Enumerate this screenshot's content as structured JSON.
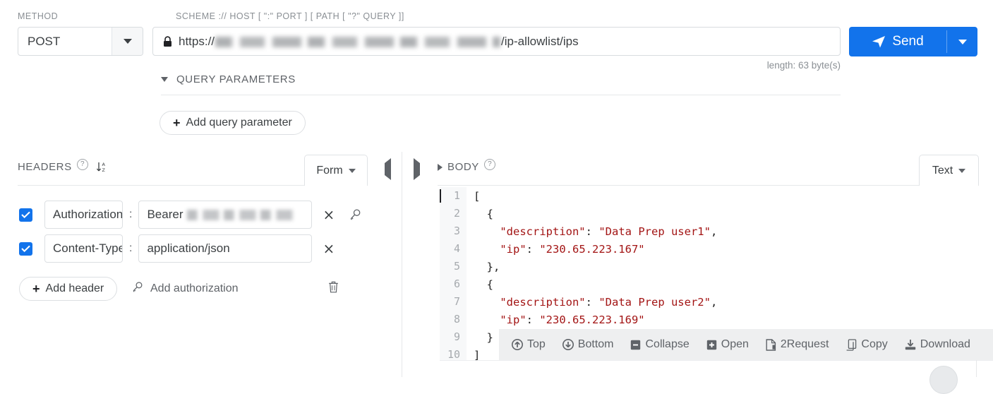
{
  "request": {
    "method_label": "METHOD",
    "method_value": "POST",
    "url_label": "SCHEME :// HOST [ \":\" PORT ] [ PATH [ \"?\" QUERY ]]",
    "url_scheme": "https://",
    "url_path": "/ip-allowlist/ips",
    "url_host_redacted": true,
    "send_label": "Send",
    "length_note": "length: 63 byte(s)"
  },
  "query_params": {
    "title": "QUERY PARAMETERS",
    "expanded": true,
    "add_label": "Add query parameter"
  },
  "headers_panel": {
    "title": "HEADERS",
    "view_mode": "Form",
    "rows": [
      {
        "enabled": true,
        "key": "Authorization",
        "value_prefix": "Bearer",
        "value_redacted": true,
        "has_key_icon": true
      },
      {
        "enabled": true,
        "key": "Content-Type",
        "value_prefix": "application/json",
        "value_redacted": false,
        "has_key_icon": false
      }
    ],
    "add_header_label": "Add header",
    "add_authorization_label": "Add authorization"
  },
  "body_panel": {
    "title": "BODY",
    "expanded": false,
    "view_mode": "Text",
    "lines": [
      {
        "n": "1",
        "code": "["
      },
      {
        "n": "2",
        "code": "  {"
      },
      {
        "n": "3",
        "code": "    \"description\": \"Data Prep user1\","
      },
      {
        "n": "4",
        "code": "    \"ip\": \"230.65.223.167\""
      },
      {
        "n": "5",
        "code": "  },"
      },
      {
        "n": "6",
        "code": "  {"
      },
      {
        "n": "7",
        "code": "    \"description\": \"Data Prep user2\","
      },
      {
        "n": "8",
        "code": "    \"ip\": \"230.65.223.169\""
      },
      {
        "n": "9",
        "code": "  }"
      },
      {
        "n": "10",
        "code": "]"
      }
    ],
    "toolbar": [
      {
        "icon": "arrow-up-circle-icon",
        "label": "Top"
      },
      {
        "icon": "arrow-down-circle-icon",
        "label": "Bottom"
      },
      {
        "icon": "minus-square-icon",
        "label": "Collapse"
      },
      {
        "icon": "plus-square-icon",
        "label": "Open"
      },
      {
        "icon": "file-icon",
        "label": "2Request"
      },
      {
        "icon": "copy-icon",
        "label": "Copy"
      },
      {
        "icon": "download-icon",
        "label": "Download"
      }
    ]
  },
  "colors": {
    "accent": "#1273eb",
    "json_string": "#a31515",
    "muted_text": "#5f6368",
    "label_text": "#8a8f94",
    "toolbar_bg": "#eeeff0"
  }
}
